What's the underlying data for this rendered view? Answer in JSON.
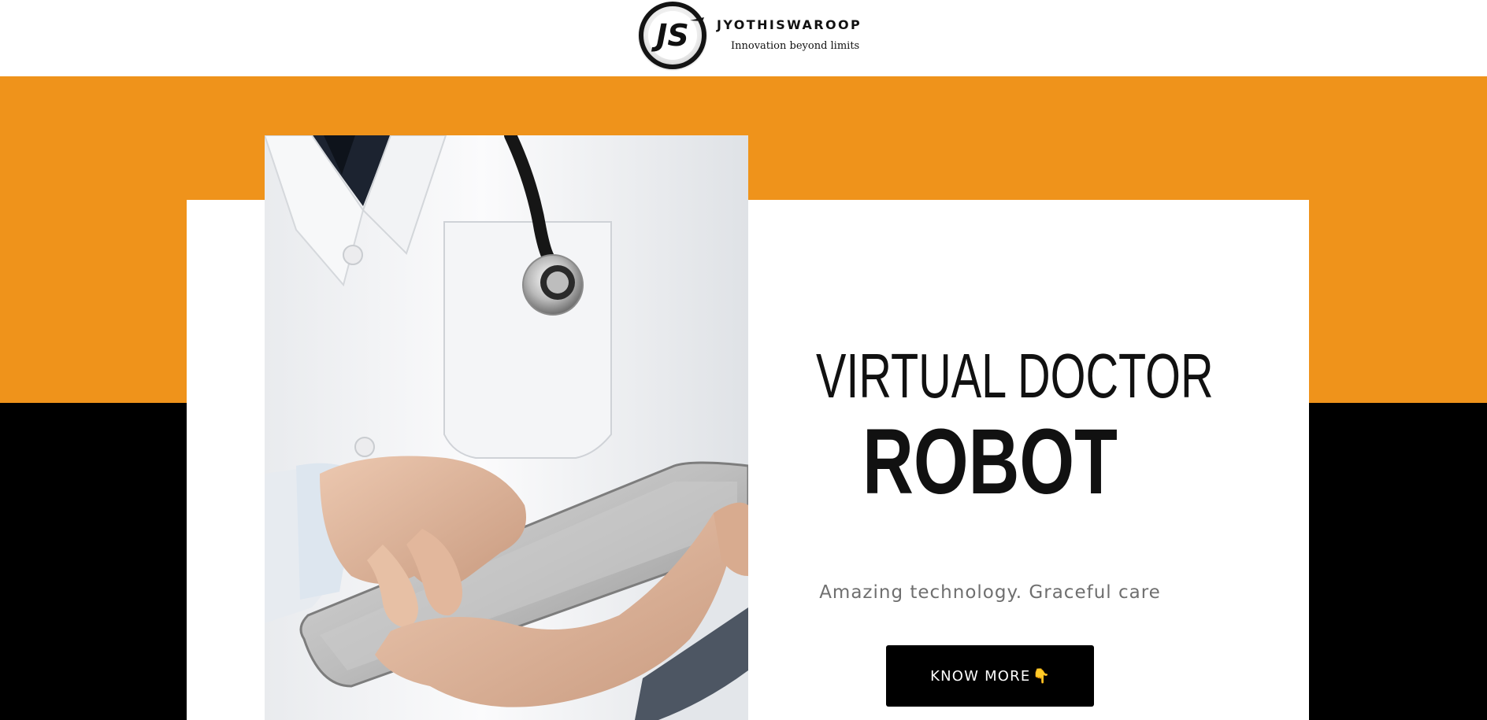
{
  "header": {
    "logo_icon": "js-monogram-logo",
    "brand_name": "JYOTHISWAROOP",
    "tagline": "Innovation beyond limits"
  },
  "hero": {
    "title_line1": "VIRTUAL DOCTOR",
    "title_line2": "ROBOT",
    "subtitle": "Amazing technology. Graceful care",
    "cta_label": "KNOW MORE",
    "cta_icon": "👇",
    "image_icon": "doctor-with-tablet-photo"
  },
  "colors": {
    "orange_band": "#EF931B",
    "black_band": "#000000",
    "card": "#FFFFFF",
    "button": "#000000",
    "button_text": "#FFFFFF",
    "subtitle_text": "#6F6F6F"
  }
}
